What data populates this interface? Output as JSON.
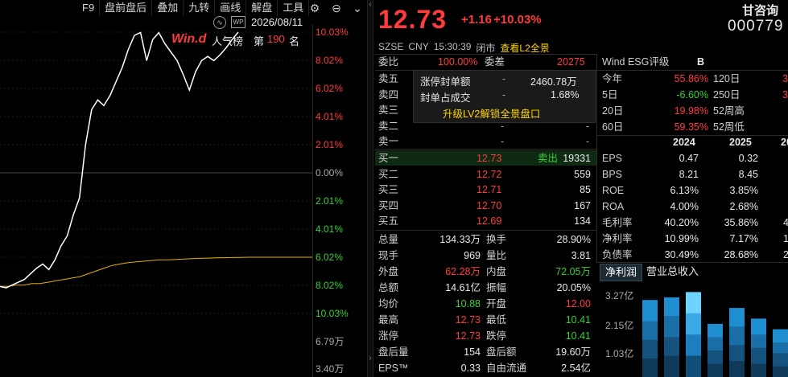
{
  "toolbar": {
    "items": [
      "F9",
      "盘前盘后",
      "叠加",
      "九转",
      "画线",
      "解盘",
      "工具"
    ]
  },
  "chart": {
    "date": "2026/08/11",
    "logo": "Win.d",
    "popularity_label": "人气榜",
    "rank_prefix": "第",
    "rank_value": "190",
    "rank_suffix": "名",
    "price_axis": [
      "10.03%",
      "8.02%",
      "6.02%",
      "4.01%",
      "2.01%",
      "0.00%",
      "2.01%",
      "4.01%",
      "6.02%",
      "8.02%",
      "10.03%"
    ],
    "volume_axis": [
      "6.79万",
      "3.40万"
    ],
    "intraday_pct": [
      -8.1,
      -8.2,
      -8.0,
      -7.8,
      -7.6,
      -7.2,
      -6.8,
      -6.5,
      -6.9,
      -6.2,
      -5.2,
      -4.5,
      -3.0,
      -1.8,
      2.0,
      4.5,
      5.2,
      4.8,
      5.5,
      6.5,
      7.5,
      8.8,
      9.8,
      10.0,
      8.0,
      9.5,
      10.0,
      9.2,
      8.6,
      8.0,
      7.0,
      5.9,
      7.2,
      8.0,
      8.3,
      8.0,
      8.4,
      8.9,
      9.5,
      10.03
    ],
    "avg_pct": [
      -8.1,
      -8.1,
      -8.0,
      -8.0,
      -7.9,
      -7.9,
      -7.8,
      -7.7,
      -7.6,
      -7.5,
      -7.4,
      -7.2,
      -7.0,
      -6.8,
      -6.6,
      -6.5,
      -6.4,
      -6.35,
      -6.3,
      -6.25,
      -6.2,
      -6.2,
      -6.18,
      -6.15,
      -6.12,
      -6.1,
      -6.08,
      -6.06,
      -6.05,
      -6.04,
      -6.03,
      -6.02,
      -6.02,
      -6.02,
      -6.02,
      -6.02,
      -6.02,
      -6.02,
      -6.02,
      -6.02
    ]
  },
  "quote": {
    "price": "12.73",
    "change": "+1.16",
    "change_pct": "+10.03%",
    "name": "甘咨询",
    "code": "000779",
    "exchange": "SZSE",
    "currency": "CNY",
    "time": "15:30:39",
    "status": "闭市",
    "l2_link": "查看L2全景"
  },
  "ratio": {
    "wb_label": "委比",
    "wb_value": "100.00%",
    "wc_label": "委差",
    "wc_value": "20275"
  },
  "popup": {
    "seal_label": "涨停封单额",
    "seal_dash": "-",
    "seal_value": "2460.78万",
    "deal_label": "封单占成交",
    "deal_dash": "-",
    "deal_value": "1.68%",
    "upgrade": "升级LV2解锁全景盘口"
  },
  "sell": [
    {
      "label": "卖五",
      "price": "-",
      "vol": "-"
    },
    {
      "label": "卖四",
      "price": "-",
      "vol": "-"
    },
    {
      "label": "卖三",
      "price": "-",
      "vol": "-"
    },
    {
      "label": "卖二",
      "price": "-",
      "vol": "-"
    },
    {
      "label": "卖一",
      "price": "-",
      "vol": "-"
    }
  ],
  "buy": [
    {
      "label": "买一",
      "price": "12.73",
      "vol": "19331",
      "tag": "卖出"
    },
    {
      "label": "买二",
      "price": "12.72",
      "vol": "559"
    },
    {
      "label": "买三",
      "price": "12.71",
      "vol": "85"
    },
    {
      "label": "买四",
      "price": "12.70",
      "vol": "167"
    },
    {
      "label": "买五",
      "price": "12.69",
      "vol": "134"
    }
  ],
  "stats": [
    {
      "l1": "总量",
      "v1": "134.33万",
      "c1": "white",
      "l2": "换手",
      "v2": "28.90%",
      "c2": "white"
    },
    {
      "l1": "现手",
      "v1": "969",
      "c1": "white",
      "l2": "量比",
      "v2": "3.81",
      "c2": "white"
    },
    {
      "l1": "外盘",
      "v1": "62.28万",
      "c1": "red",
      "l2": "内盘",
      "v2": "72.05万",
      "c2": "green"
    },
    {
      "l1": "总额",
      "v1": "14.61亿",
      "c1": "white",
      "l2": "振幅",
      "v2": "20.05%",
      "c2": "white"
    },
    {
      "l1": "均价",
      "v1": "10.88",
      "c1": "green",
      "l2": "开盘",
      "v2": "12.00",
      "c2": "red"
    },
    {
      "l1": "最高",
      "v1": "12.73",
      "c1": "red",
      "l2": "最低",
      "v2": "10.41",
      "c2": "green"
    },
    {
      "l1": "涨停",
      "v1": "12.73",
      "c1": "red",
      "l2": "跌停",
      "v2": "10.41",
      "c2": "green"
    },
    {
      "l1": "盘后量",
      "v1": "154",
      "c1": "white",
      "l2": "盘后额",
      "v2": "19.60万",
      "c2": "white"
    },
    {
      "l1": "EPS™",
      "v1": "0.33",
      "c1": "white",
      "l2": "自由流通",
      "v2": "2.54亿",
      "c2": "white"
    }
  ],
  "esg": {
    "label": "Wind ESG评级",
    "grade": "B"
  },
  "perf": [
    {
      "l1": "今年",
      "v1": "55.86%",
      "c1": "red",
      "l2": "120日",
      "v2": "3"
    },
    {
      "l1": "5日",
      "v1": "-6.60%",
      "c1": "green",
      "l2": "250日",
      "v2": "3"
    },
    {
      "l1": "20日",
      "v1": "19.98%",
      "c1": "red",
      "l2": "52周高",
      "v2": ""
    },
    {
      "l1": "60日",
      "v1": "59.35%",
      "c1": "red",
      "l2": "52周低",
      "v2": ""
    }
  ],
  "fin": {
    "years": [
      "2024",
      "2025",
      "20"
    ],
    "rows": [
      {
        "label": "EPS",
        "a": "0.47",
        "b": "0.32",
        "c": ""
      },
      {
        "label": "BPS",
        "a": "8.21",
        "b": "8.45",
        "c": ""
      },
      {
        "label": "ROE",
        "a": "6.13%",
        "b": "3.85%",
        "c": ""
      },
      {
        "label": "ROA",
        "a": "4.00%",
        "b": "2.68%",
        "c": ""
      },
      {
        "label": "毛利率",
        "a": "40.20%",
        "b": "35.86%",
        "c": "4"
      },
      {
        "label": "净利率",
        "a": "10.99%",
        "b": "7.17%",
        "c": "1"
      },
      {
        "label": "负债率",
        "a": "30.49%",
        "b": "28.68%",
        "c": "2"
      }
    ]
  },
  "tabs": {
    "t1": "净利润",
    "t2": "营业总收入"
  },
  "minichart": {
    "yticks": [
      "3.27亿",
      "2.15亿",
      "1.03亿"
    ],
    "groups": [
      [
        2.9,
        2.1,
        1.4,
        0.7
      ],
      [
        3.0,
        2.3,
        1.5,
        0.8
      ],
      [
        3.2,
        2.4,
        1.6,
        0.8
      ],
      [
        2.0,
        1.5,
        1.0,
        0.5
      ],
      [
        2.6,
        1.9,
        1.2,
        0.6
      ],
      [
        2.2,
        1.6,
        1.1,
        0.5
      ],
      [
        1.8,
        1.3,
        0.9,
        0.4
      ]
    ]
  }
}
